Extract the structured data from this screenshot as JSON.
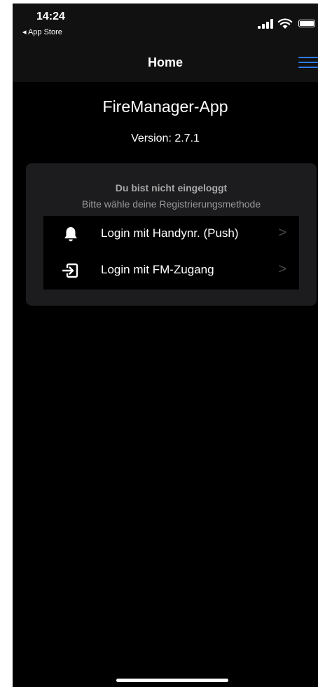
{
  "status_bar": {
    "time": "14:24",
    "back_app": "◂ App Store",
    "icons": [
      "signal-icon",
      "wifi-icon",
      "battery-icon"
    ]
  },
  "nav": {
    "title": "Home",
    "menu_icon": "hamburger-menu-icon",
    "accent_color": "#2f7bf5"
  },
  "app": {
    "title": "FireManager-App",
    "version": "Version: 2.7.1"
  },
  "login_card": {
    "title": "Du bist nicht eingeloggt",
    "subtitle": "Bitte wähle deine Registrierungsmethode",
    "options": [
      {
        "label": "Login mit Handynr. (Push)",
        "icon": "bell-icon",
        "chevron": ">"
      },
      {
        "label": "Login mit FM-Zugang",
        "icon": "login-arrow-icon",
        "chevron": ">"
      }
    ]
  }
}
